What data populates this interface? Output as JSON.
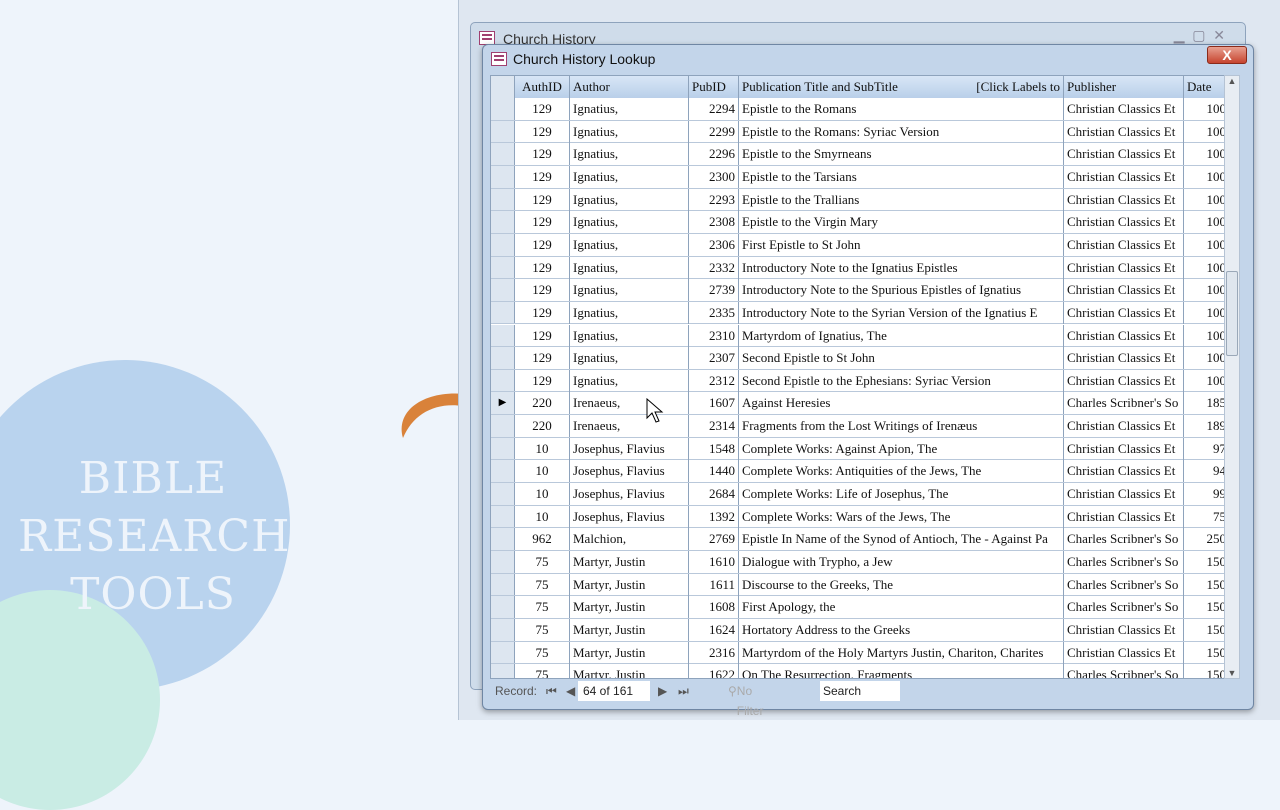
{
  "logo": {
    "lines": [
      "BIBLE",
      "RESEARCH",
      "TOOLS"
    ]
  },
  "outer_window": {
    "title": "Church History"
  },
  "window": {
    "title": "Church History Lookup",
    "close": "X"
  },
  "columns": [
    "AuthID",
    "Author",
    "PubID",
    "Publication Title and SubTitle",
    "Publisher",
    "Date"
  ],
  "header_hint": "[Click Labels to",
  "current_row": 13,
  "rows": [
    [
      "129",
      "Ignatius,",
      "2294",
      "Epistle to the Romans",
      "Christian Classics Et",
      "100"
    ],
    [
      "129",
      "Ignatius,",
      "2299",
      "Epistle to the Romans: Syriac Version",
      "Christian Classics Et",
      "100"
    ],
    [
      "129",
      "Ignatius,",
      "2296",
      "Epistle to the Smyrneans",
      "Christian Classics Et",
      "100"
    ],
    [
      "129",
      "Ignatius,",
      "2300",
      "Epistle to the Tarsians",
      "Christian Classics Et",
      "100"
    ],
    [
      "129",
      "Ignatius,",
      "2293",
      "Epistle to the Trallians",
      "Christian Classics Et",
      "100"
    ],
    [
      "129",
      "Ignatius,",
      "2308",
      "Epistle to the Virgin Mary",
      "Christian Classics Et",
      "100"
    ],
    [
      "129",
      "Ignatius,",
      "2306",
      "First Epistle to St John",
      "Christian Classics Et",
      "100"
    ],
    [
      "129",
      "Ignatius,",
      "2332",
      "Introductory Note to the Ignatius Epistles",
      "Christian Classics Et",
      "100"
    ],
    [
      "129",
      "Ignatius,",
      "2739",
      "Introductory Note to the Spurious Epistles of Ignatius",
      "Christian Classics Et",
      "100"
    ],
    [
      "129",
      "Ignatius,",
      "2335",
      "Introductory Note to the Syrian Version of the Ignatius E",
      "Christian Classics Et",
      "100"
    ],
    [
      "129",
      "Ignatius,",
      "2310",
      "Martyrdom of Ignatius, The",
      "Christian Classics Et",
      "100"
    ],
    [
      "129",
      "Ignatius,",
      "2307",
      "Second Epistle to St John",
      "Christian Classics Et",
      "100"
    ],
    [
      "129",
      "Ignatius,",
      "2312",
      "Second Epistle to the Ephesians: Syriac Version",
      "Christian Classics Et",
      "100"
    ],
    [
      "220",
      "Irenaeus,",
      "1607",
      "Against Heresies",
      "Charles Scribner's So",
      "185"
    ],
    [
      "220",
      "Irenaeus,",
      "2314",
      "Fragments from the Lost Writings of Irenæus",
      "Christian Classics Et",
      "189"
    ],
    [
      "10",
      "Josephus, Flavius",
      "1548",
      "Complete Works: Against Apion, The",
      "Christian Classics Et",
      "97"
    ],
    [
      "10",
      "Josephus, Flavius",
      "1440",
      "Complete Works: Antiquities of the Jews, The",
      "Christian Classics Et",
      "94"
    ],
    [
      "10",
      "Josephus, Flavius",
      "2684",
      "Complete Works: Life of Josephus, The",
      "Christian Classics Et",
      "99"
    ],
    [
      "10",
      "Josephus, Flavius",
      "1392",
      "Complete Works: Wars of the Jews, The",
      "Christian Classics Et",
      "75"
    ],
    [
      "962",
      "Malchion,",
      "2769",
      "Epistle In Name of the Synod of Antioch, The - Against Pa",
      "Charles Scribner's So",
      "250"
    ],
    [
      "75",
      "Martyr, Justin",
      "1610",
      "Dialogue with Trypho, a Jew",
      "Charles Scribner's So",
      "150"
    ],
    [
      "75",
      "Martyr, Justin",
      "1611",
      "Discourse to the Greeks, The",
      "Charles Scribner's So",
      "150"
    ],
    [
      "75",
      "Martyr, Justin",
      "1608",
      "First Apology, the",
      "Charles Scribner's So",
      "150"
    ],
    [
      "75",
      "Martyr, Justin",
      "1624",
      "Hortatory Address to the Greeks",
      "Christian Classics Et",
      "150"
    ],
    [
      "75",
      "Martyr, Justin",
      "2316",
      "Martyrdom of the Holy Martyrs Justin, Chariton, Charites",
      "Christian Classics Et",
      "150"
    ],
    [
      "75",
      "Martyr, Justin",
      "1622",
      "On The Resurrection, Fragments",
      "Charles Scribner's So",
      "150"
    ]
  ],
  "nav": {
    "label": "Record:",
    "position": "64 of 161",
    "filter": "No Filter",
    "search": "Search"
  }
}
